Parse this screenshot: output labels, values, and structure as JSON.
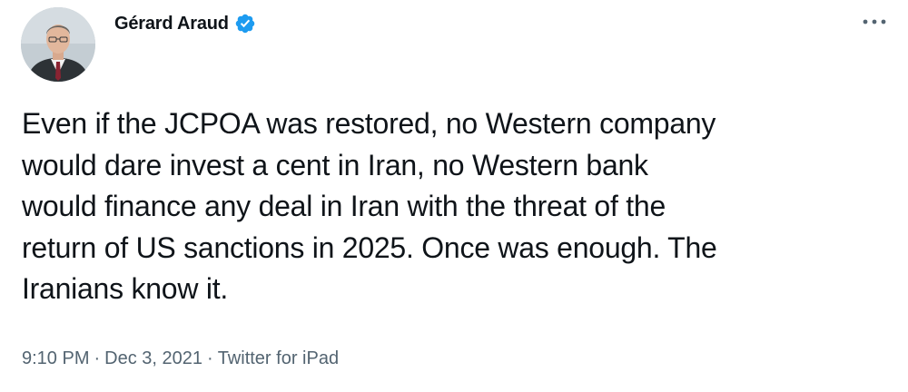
{
  "author": {
    "display_name": "Gérard Araud",
    "verified": true
  },
  "tweet": {
    "text": "Even if the JCPOA was restored, no Western company\nwould dare invest a cent in Iran, no Western bank\nwould finance any deal in Iran with the threat of the\nreturn of US sanctions in 2025. Once was enough. The\nIranians know it.",
    "time": "9:10 PM",
    "date": "Dec 3, 2021",
    "source": "Twitter for iPad",
    "separator": "·"
  },
  "icons": {
    "verified": "verified-badge-icon",
    "more": "more-dots-icon"
  },
  "colors": {
    "text": "#0f1419",
    "secondary": "#536471",
    "verified_blue": "#1d9bf0",
    "background": "#ffffff"
  }
}
